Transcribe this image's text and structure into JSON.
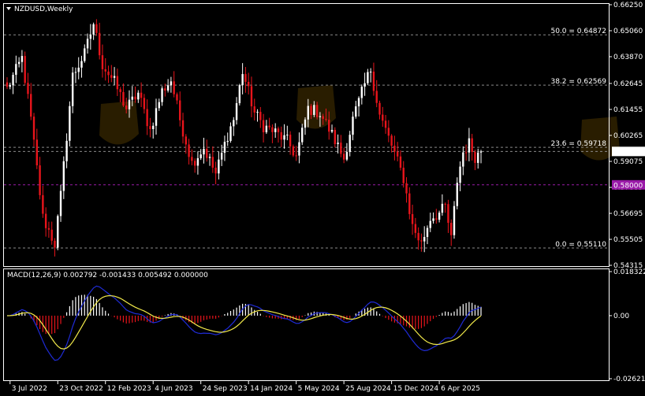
{
  "symbol_title": "NZDUSD,Weekly",
  "colors": {
    "background": "#000000",
    "frame": "#ffffff",
    "bull": "#ffffff",
    "bear": "#e8141b",
    "fib_line": "#8a8a8a",
    "current_price_bg": "#ffffff",
    "current_price_text": "#000000",
    "level_line": "#9a1aa8",
    "level_bg": "#9a1aa8",
    "macd_line": "#1f2bd6",
    "signal_line": "#f2ea4a",
    "hist_pos": "#ffffff",
    "hist_neg": "#e8141b",
    "watermark": "#3a2a00"
  },
  "price_axis": {
    "ticks": [
      "0.66250",
      "0.65060",
      "0.63870",
      "0.62645",
      "0.61455",
      "0.60265",
      "0.59075",
      "0.57885",
      "0.56695",
      "0.55505",
      "0.54315"
    ]
  },
  "fib_levels": [
    {
      "label": "50.0 = 0.64872",
      "value": 0.64872
    },
    {
      "label": "38.2 = 0.62569",
      "value": 0.62569
    },
    {
      "label": "23.6 = 0.59718",
      "value": 0.59718
    },
    {
      "label": "0.0 = 0.55110",
      "value": 0.5511
    }
  ],
  "current_price": {
    "label": "0.59530",
    "value": 0.5953
  },
  "marked_level": {
    "label": "0.58000",
    "value": 0.58
  },
  "macd": {
    "title": "MACD(12,26,9) 0.002792 -0.001433 0.005492 0.000000",
    "ticks": [
      "0.018322",
      "0.00",
      "-0.026212"
    ]
  },
  "time_axis": {
    "labels": [
      "3 Jul 2022",
      "23 Oct 2022",
      "12 Feb 2023",
      "4 Jun 2023",
      "24 Sep 2023",
      "14 Jan 2024",
      "5 May 2024",
      "25 Aug 2024",
      "15 Dec 2024",
      "6 Apr 2025"
    ]
  },
  "chart_data": {
    "type": "candlestick",
    "title": "NZDUSD,Weekly",
    "timeframe": "Weekly",
    "ylim": [
      0.54315,
      0.6625
    ],
    "macd_ylim": [
      -0.026212,
      0.018322
    ],
    "candle_count": 160,
    "x_start": "3 Jul 2022",
    "x_end": "6 Apr 2025",
    "waypoints": [
      {
        "i": 0,
        "price": 0.624
      },
      {
        "i": 5,
        "price": 0.638
      },
      {
        "i": 8,
        "price": 0.61
      },
      {
        "i": 12,
        "price": 0.565
      },
      {
        "i": 16,
        "price": 0.553
      },
      {
        "i": 18,
        "price": 0.575
      },
      {
        "i": 22,
        "price": 0.63
      },
      {
        "i": 26,
        "price": 0.64
      },
      {
        "i": 29,
        "price": 0.654
      },
      {
        "i": 32,
        "price": 0.635
      },
      {
        "i": 36,
        "price": 0.627
      },
      {
        "i": 40,
        "price": 0.615
      },
      {
        "i": 44,
        "price": 0.622
      },
      {
        "i": 48,
        "price": 0.605
      },
      {
        "i": 52,
        "price": 0.623
      },
      {
        "i": 55,
        "price": 0.628
      },
      {
        "i": 58,
        "price": 0.61
      },
      {
        "i": 62,
        "price": 0.59
      },
      {
        "i": 66,
        "price": 0.597
      },
      {
        "i": 70,
        "price": 0.585
      },
      {
        "i": 74,
        "price": 0.603
      },
      {
        "i": 76,
        "price": 0.61
      },
      {
        "i": 79,
        "price": 0.632
      },
      {
        "i": 83,
        "price": 0.613
      },
      {
        "i": 86,
        "price": 0.607
      },
      {
        "i": 90,
        "price": 0.604
      },
      {
        "i": 94,
        "price": 0.6
      },
      {
        "i": 97,
        "price": 0.593
      },
      {
        "i": 101,
        "price": 0.615
      },
      {
        "i": 105,
        "price": 0.613
      },
      {
        "i": 109,
        "price": 0.603
      },
      {
        "i": 113,
        "price": 0.592
      },
      {
        "i": 116,
        "price": 0.61
      },
      {
        "i": 120,
        "price": 0.626
      },
      {
        "i": 122,
        "price": 0.633
      },
      {
        "i": 125,
        "price": 0.612
      },
      {
        "i": 129,
        "price": 0.598
      },
      {
        "i": 133,
        "price": 0.583
      },
      {
        "i": 136,
        "price": 0.561
      },
      {
        "i": 139,
        "price": 0.553
      },
      {
        "i": 142,
        "price": 0.565
      },
      {
        "i": 145,
        "price": 0.567
      },
      {
        "i": 147,
        "price": 0.57
      },
      {
        "i": 149,
        "price": 0.555
      },
      {
        "i": 151,
        "price": 0.582
      },
      {
        "i": 153,
        "price": 0.595
      },
      {
        "i": 155,
        "price": 0.599
      },
      {
        "i": 157,
        "price": 0.593
      },
      {
        "i": 159,
        "price": 0.5953
      }
    ]
  }
}
